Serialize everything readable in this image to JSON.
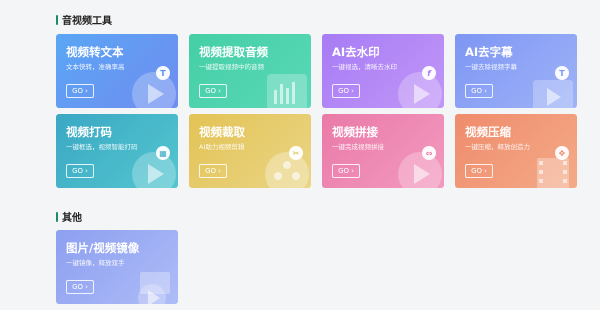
{
  "sections": {
    "audio_video": {
      "title": "音视频工具"
    },
    "other": {
      "title": "其他"
    }
  },
  "go_label": "GO",
  "tools": [
    {
      "title": "视频转文本",
      "desc": "文本快转，准确率高",
      "icon": "text-T-icon"
    },
    {
      "title": "视频提取音频",
      "desc": "一键提取视频中的音频",
      "icon": "audio-wave-icon"
    },
    {
      "title": "AI去水印",
      "desc": "一键视选，清晰去水印",
      "icon": "watermark-icon"
    },
    {
      "title": "AI去字幕",
      "desc": "一键去除视频字幕",
      "icon": "subtitle-icon"
    },
    {
      "title": "视频打码",
      "desc": "一键框选，视频智能打码",
      "icon": "mosaic-icon"
    },
    {
      "title": "视频裁取",
      "desc": "AI助力视频剪辑",
      "icon": "film-reel-icon"
    },
    {
      "title": "视频拼接",
      "desc": "一键完成视频拼接",
      "icon": "merge-icon"
    },
    {
      "title": "视频压缩",
      "desc": "一键压缩，释放创造力",
      "icon": "compress-icon"
    },
    {
      "title": "图片/视频镜像",
      "desc": "一键镜像，释放双手",
      "icon": "mirror-icon"
    }
  ]
}
